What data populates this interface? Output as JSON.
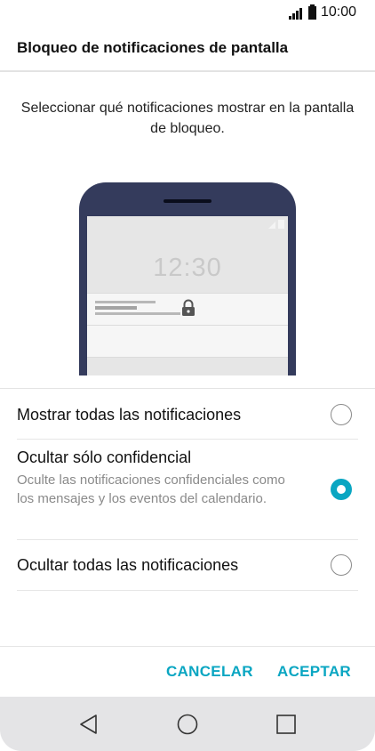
{
  "status_bar": {
    "time": "10:00",
    "icons": [
      "signal-icon",
      "battery-icon"
    ]
  },
  "header": {
    "title": "Bloqueo de notificaciones de pantalla"
  },
  "intro": {
    "text": "Seleccionar qué notificaciones mostrar en la pantalla de bloqueo."
  },
  "illustration": {
    "lock_screen_time": "12:30",
    "icons": [
      "lock-icon",
      "signal-icon"
    ]
  },
  "options": [
    {
      "title": "Mostrar todas las notificaciones",
      "description": "",
      "selected": false
    },
    {
      "title": "Ocultar sólo confidencial",
      "description": "Oculte las notificaciones confidenciales como los mensajes y los eventos del calendario.",
      "selected": true
    },
    {
      "title": "Ocultar todas las notificaciones",
      "description": "",
      "selected": false
    }
  ],
  "actions": {
    "cancel_label": "CANCELAR",
    "accept_label": "ACEPTAR"
  },
  "nav_bar": {
    "icons": [
      "back-icon",
      "home-icon",
      "recent-apps-icon"
    ]
  },
  "colors": {
    "accent": "#0aa6c2",
    "phone_frame": "#343b5c",
    "nav_bar_bg": "#e4e4e6"
  }
}
